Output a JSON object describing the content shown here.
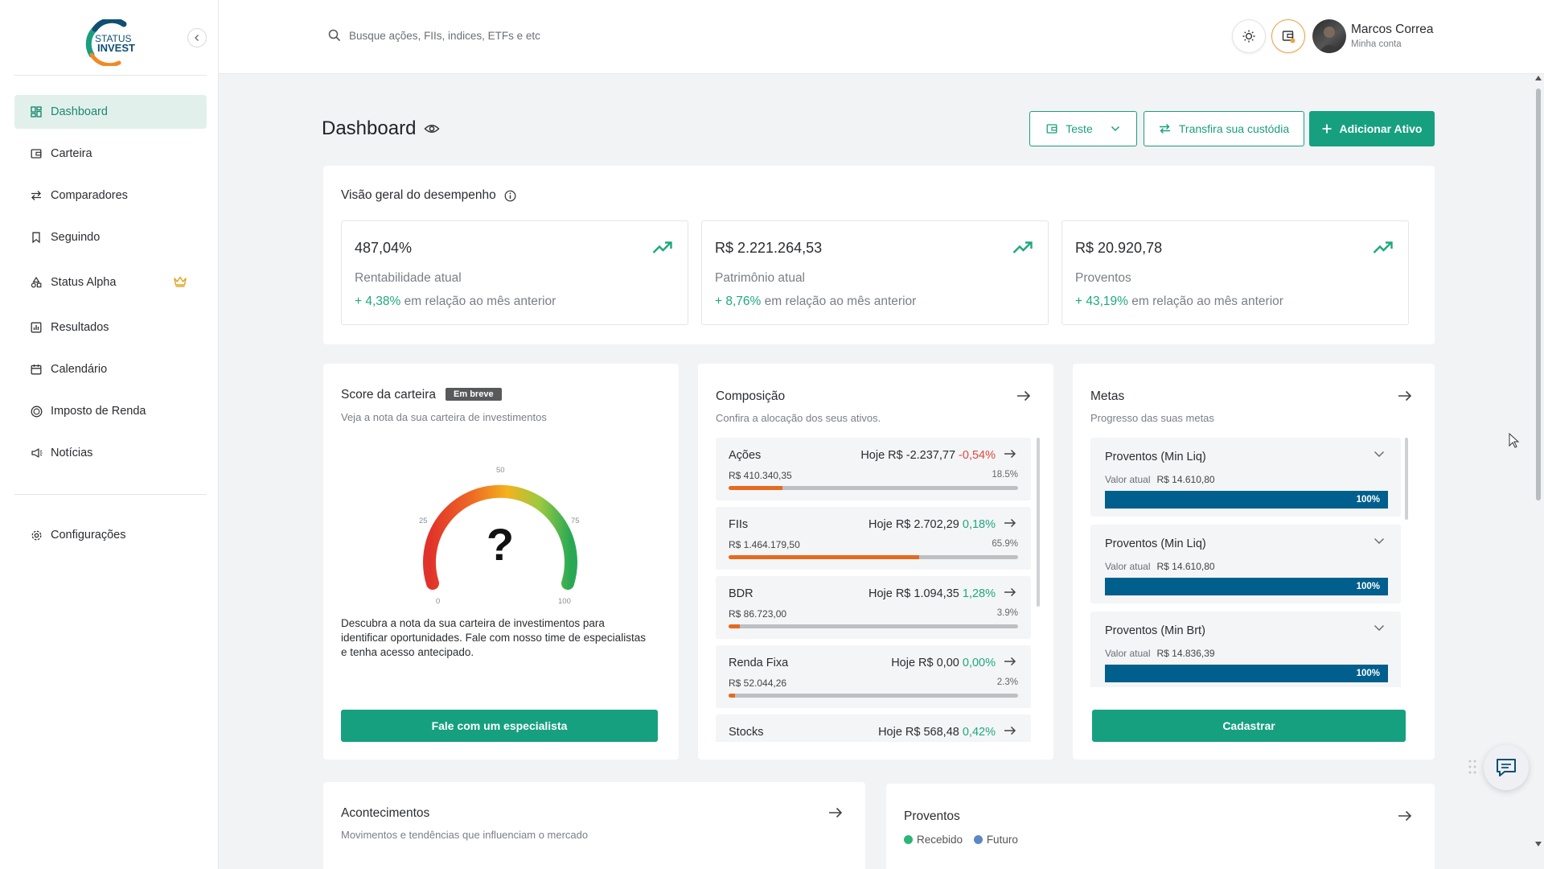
{
  "brand": {
    "line1": "STATUS",
    "line2": "INVEST"
  },
  "sidebar": {
    "items": [
      {
        "label": "Dashboard",
        "active": true
      },
      {
        "label": "Carteira"
      },
      {
        "label": "Comparadores"
      },
      {
        "label": "Seguindo"
      },
      {
        "label": "Status Alpha"
      },
      {
        "label": "Resultados"
      },
      {
        "label": "Calendário"
      },
      {
        "label": "Imposto de Renda"
      },
      {
        "label": "Notícias"
      }
    ],
    "settings_label": "Configurações"
  },
  "topbar": {
    "search_placeholder": "Busque ações, FIIs, indices, ETFs e etc",
    "user_name": "Marcos Correa",
    "user_sub": "Minha conta"
  },
  "header": {
    "title": "Dashboard",
    "wallet_select": "Teste",
    "transfer_label": "Transfira sua custódia",
    "add_label": "Adicionar Ativo"
  },
  "overview": {
    "title": "Visão geral do desempenho",
    "suffix": "em relação ao mês anterior",
    "kpis": [
      {
        "value": "487,04%",
        "label": "Rentabilidade atual",
        "delta": "+ 4,38%"
      },
      {
        "value": "R$ 2.221.264,53",
        "label": "Patrimônio atual",
        "delta": "+ 8,76%"
      },
      {
        "value": "R$ 20.920,78",
        "label": "Proventos",
        "delta": "+ 43,19%"
      }
    ]
  },
  "score": {
    "title": "Score da carteira",
    "badge": "Em breve",
    "subtitle": "Veja a nota da sua carteira de investimentos",
    "gauge_value": "?",
    "gauge_ticks": [
      "0",
      "25",
      "50",
      "75",
      "100"
    ],
    "description": "Descubra a nota da sua carteira de investimentos para identificar oportunidades. Fale com nosso time de especialistas e tenha acesso antecipado.",
    "cta": "Fale com um especialista"
  },
  "composition": {
    "title": "Composição",
    "subtitle": "Confira a alocação dos seus ativos.",
    "today_prefix": "Hoje",
    "items": [
      {
        "name": "Ações",
        "today": "R$ -2.237,77",
        "change": "-0,54%",
        "negative": true,
        "amount": "R$ 410.340,35",
        "pct": "18.5%",
        "share": 18.5
      },
      {
        "name": "FIIs",
        "today": "R$ 2.702,29",
        "change": "0,18%",
        "negative": false,
        "amount": "R$ 1.464.179,50",
        "pct": "65.9%",
        "share": 65.9
      },
      {
        "name": "BDR",
        "today": "R$ 1.094,35",
        "change": "1,28%",
        "negative": false,
        "amount": "R$ 86.723,00",
        "pct": "3.9%",
        "share": 3.9
      },
      {
        "name": "Renda Fixa",
        "today": "R$ 0,00",
        "change": "0,00%",
        "negative": false,
        "amount": "R$ 52.044,26",
        "pct": "2.3%",
        "share": 2.3
      },
      {
        "name": "Stocks",
        "today": "R$ 568,48",
        "change": "0,42%",
        "negative": false,
        "amount": "",
        "pct": "",
        "share": 0
      }
    ]
  },
  "goals": {
    "title": "Metas",
    "subtitle": "Progresso das suas metas",
    "current_label": "Valor atual",
    "items": [
      {
        "name": "Proventos (Min Liq)",
        "value": "R$ 14.610,80",
        "progress": "100%"
      },
      {
        "name": "Proventos (Min Liq)",
        "value": "R$ 14.610,80",
        "progress": "100%"
      },
      {
        "name": "Proventos (Min Brt)",
        "value": "R$ 14.836,39",
        "progress": "100%"
      }
    ],
    "cta": "Cadastrar"
  },
  "events": {
    "title": "Acontecimentos",
    "subtitle": "Movimentos e tendências que influenciam o mercado"
  },
  "dividends": {
    "title": "Proventos",
    "legend": [
      {
        "label": "Recebido",
        "color": "#2bb673"
      },
      {
        "label": "Futuro",
        "color": "#5b87c5"
      }
    ]
  },
  "colors": {
    "primary": "#16a07f",
    "progress": "#005f8d",
    "bar_fill": "#e66a1e",
    "positive": "#1ea97c",
    "negative": "#e0483d"
  }
}
